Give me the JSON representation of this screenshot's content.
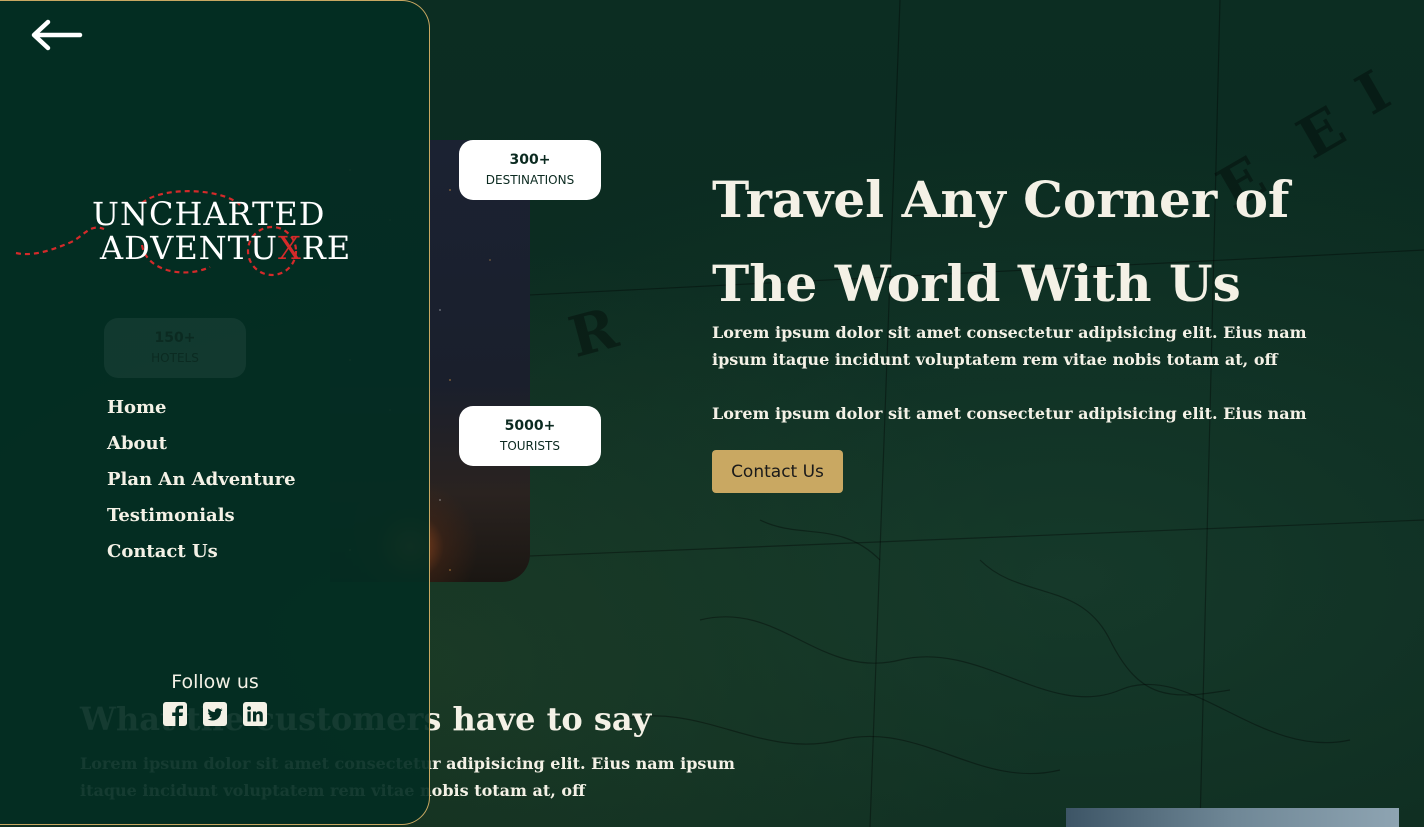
{
  "sidebar": {
    "logo": {
      "line1": "UNCHARTED",
      "line2": "ADVENTU",
      "line2_x": "X",
      "line2_end": "RE"
    },
    "ghost_stat": {
      "number": "150+",
      "label": "HOTELS"
    },
    "nav": [
      {
        "label": "Home"
      },
      {
        "label": "About"
      },
      {
        "label": "Plan An Adventure"
      },
      {
        "label": "Testimonials"
      },
      {
        "label": "Contact Us"
      }
    ],
    "follow_label": "Follow us",
    "socials": [
      "facebook-icon",
      "twitter-icon",
      "linkedin-icon"
    ]
  },
  "stats": [
    {
      "number": "300+",
      "label": "DESTINATIONS"
    },
    {
      "number": "5000+",
      "label": "TOURISTS"
    }
  ],
  "hero": {
    "title": "Travel Any Corner of The World With Us",
    "paragraph1": "Lorem ipsum dolor sit amet consectetur adipisicing elit. Eius nam ipsum itaque incidunt voluptatem rem vitae nobis totam at, off",
    "paragraph2": "Lorem ipsum dolor sit amet consectetur adipisicing elit. Eius nam",
    "button_label": "Contact Us"
  },
  "testimonials": {
    "title": "What the customers have to say",
    "text": "Lorem ipsum dolor sit amet consectetur adipisicing elit. Eius nam ipsum itaque incidunt voluptatem rem vitae nobis totam at, off"
  },
  "colors": {
    "background": "#0b2a20",
    "sidebar": "#032d22",
    "accent": "#c9a862",
    "text": "#f4f1e6",
    "logo_red": "#d42a2a"
  }
}
